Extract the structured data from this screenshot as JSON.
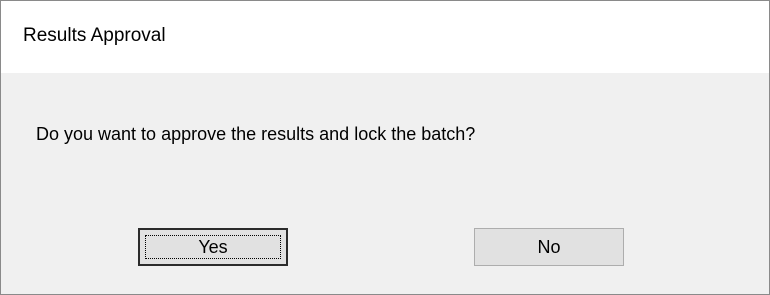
{
  "dialog": {
    "title": "Results Approval",
    "message": "Do you want to approve the results and lock the batch?",
    "buttons": {
      "yes_label": "Yes",
      "no_label": "No"
    },
    "default_button": "Yes"
  }
}
